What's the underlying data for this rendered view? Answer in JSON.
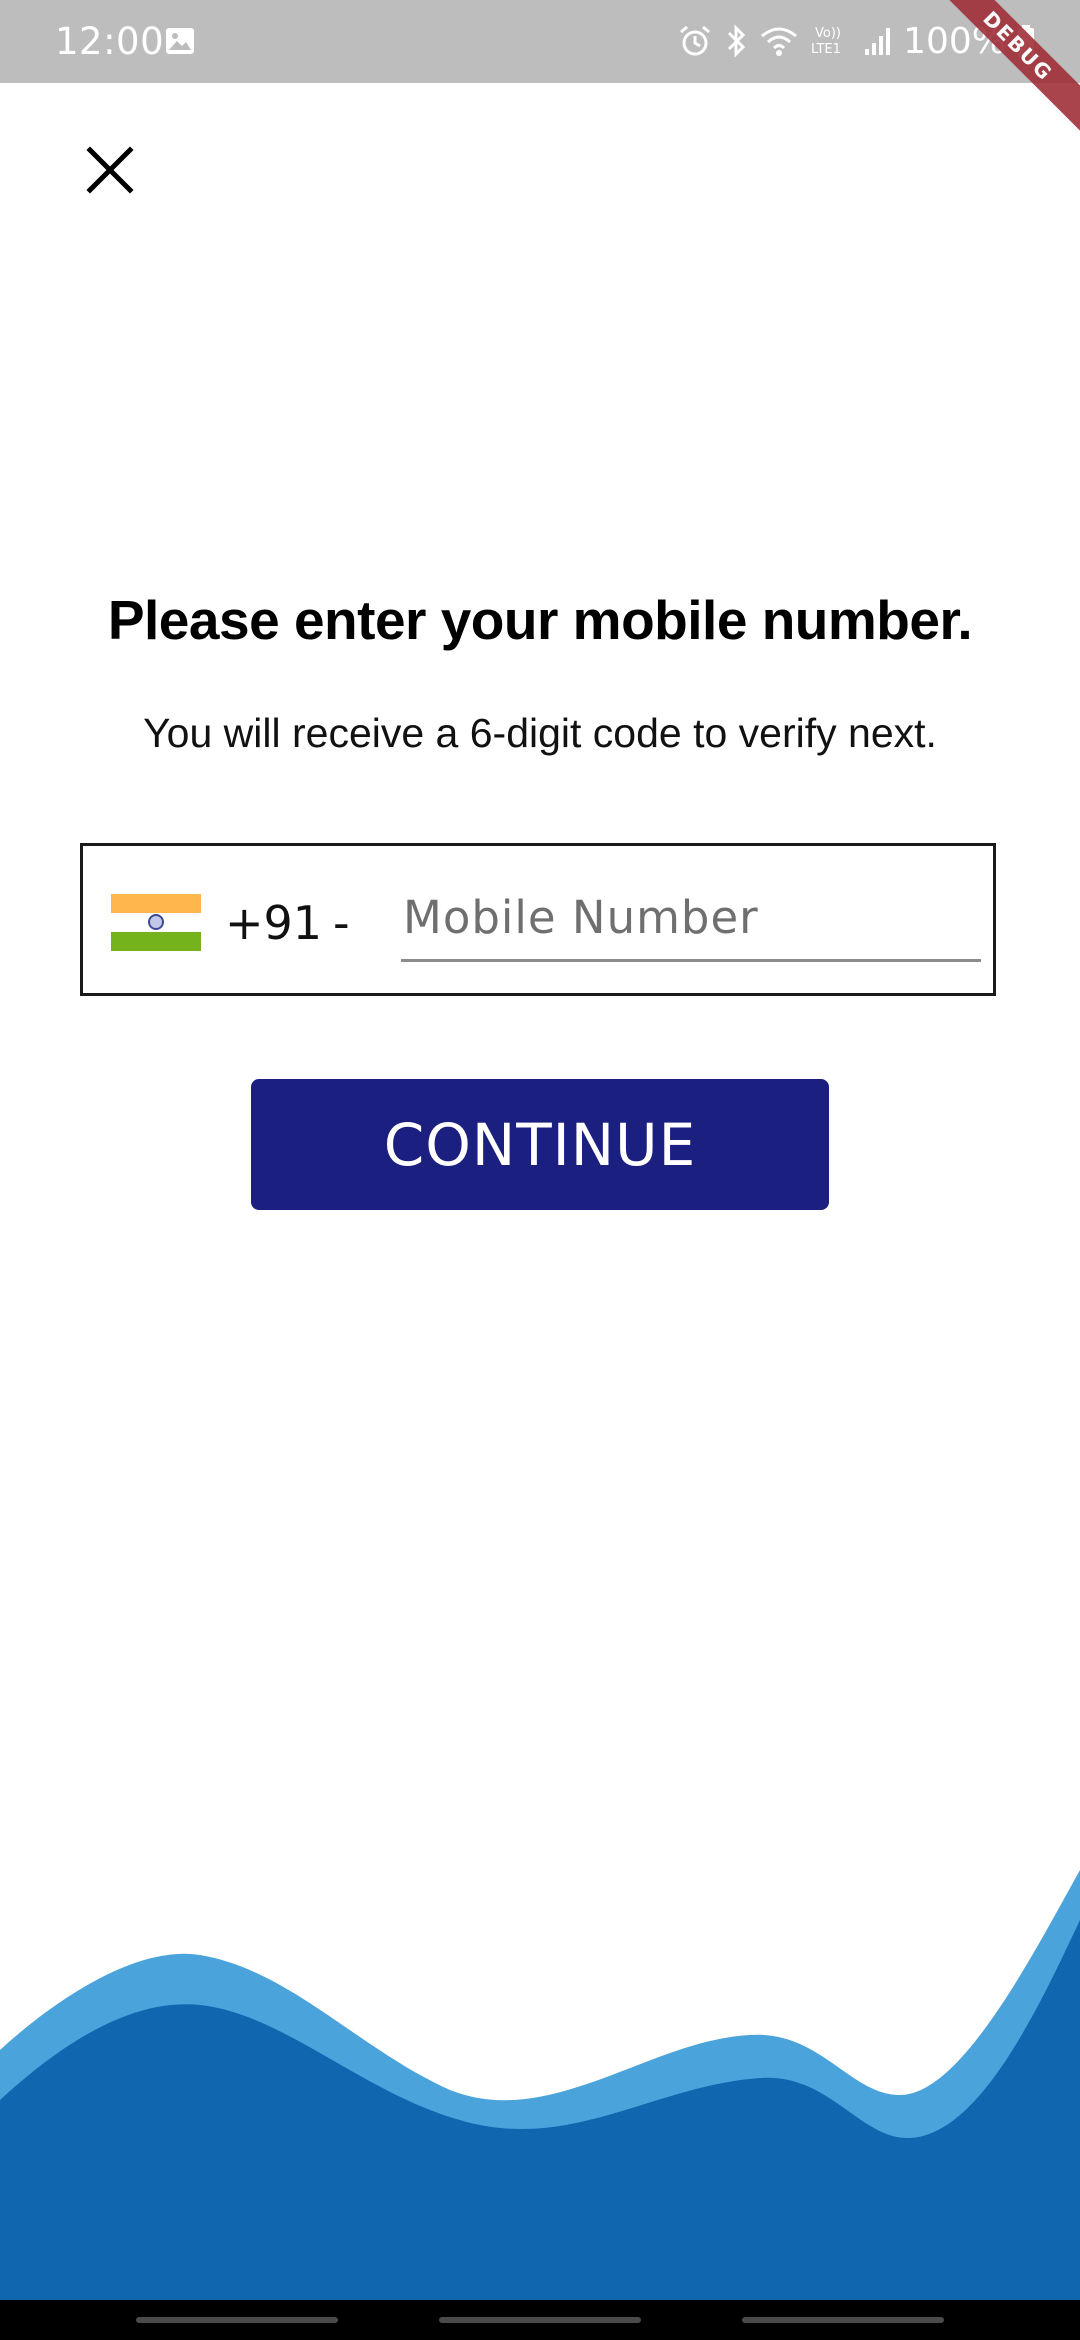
{
  "status_bar": {
    "time": "12:00",
    "battery": "100%",
    "icons": [
      "gallery-icon",
      "alarm-icon",
      "bluetooth-icon",
      "wifi-icon",
      "volte-lte-icon",
      "signal-icon",
      "battery-icon"
    ]
  },
  "debug_banner": "DEBUG",
  "header": {
    "close_icon": "close-icon"
  },
  "main": {
    "title": "Please enter your mobile number.",
    "subtitle": "You will receive a 6-digit code to verify next.",
    "phone": {
      "country_flag": "india-flag-icon",
      "dial_code": "+91",
      "separator": "-",
      "placeholder": "Mobile Number",
      "value": ""
    },
    "continue_label": "CONTINUE"
  },
  "colors": {
    "primary_button": "#1b2080",
    "wave_light": "#4aa3db",
    "wave_dark": "#1166b0",
    "status_bar": "#bdbdbd"
  }
}
